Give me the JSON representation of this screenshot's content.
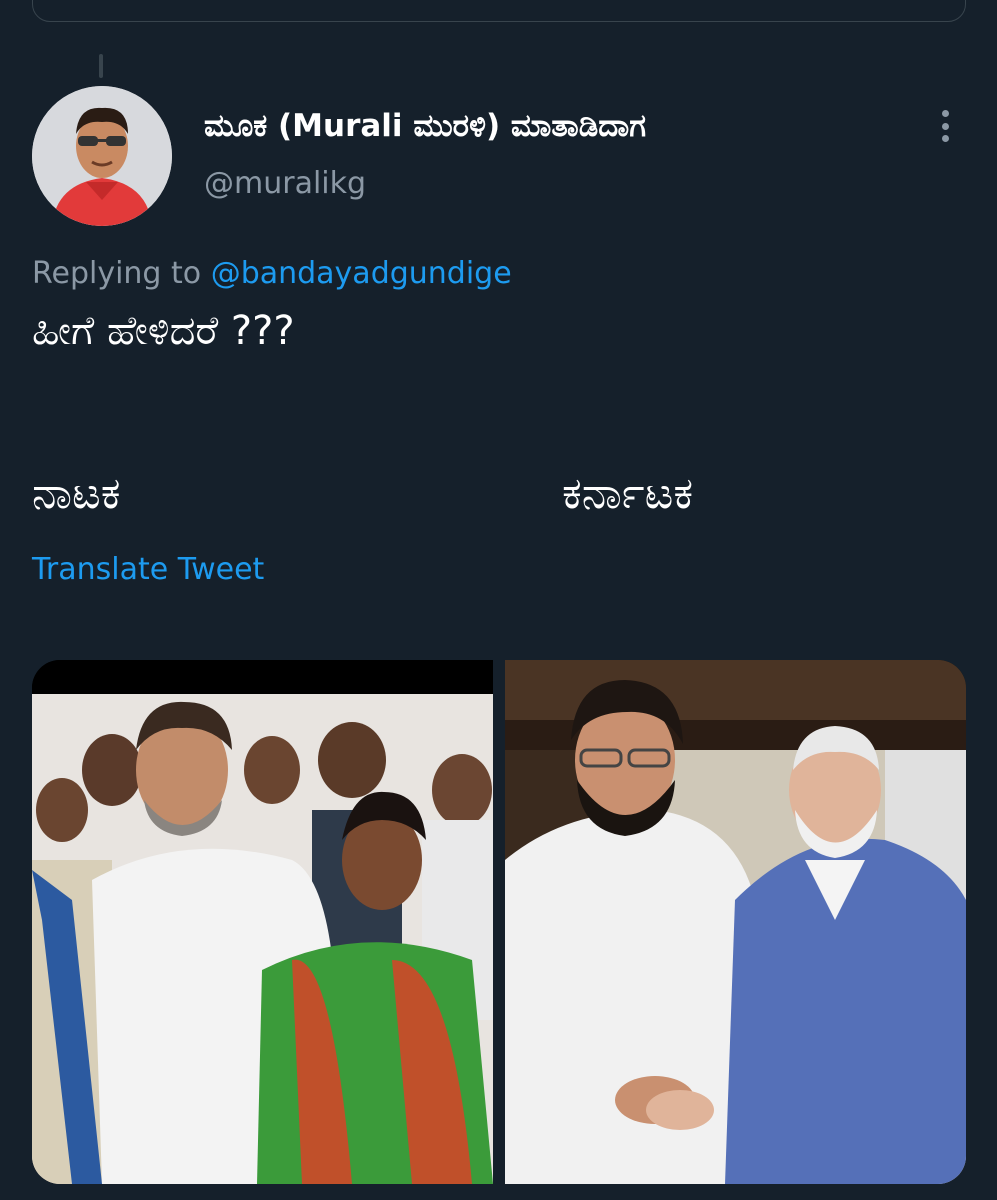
{
  "tweet": {
    "author": {
      "display_name": "ಮೂಕ (Murali ಮುರಳಿ) ಮಾತಾಡಿದಾಗ",
      "handle": "@muralikg"
    },
    "replying_prefix": "Replying to",
    "replying_to": "@bandayadgundige",
    "text_line1": "ಹೀಗೆ ಹೇಳಿದರೆ ???",
    "word_left": "ನಾಟಕ",
    "word_right": "ಕರ್ನಾಟಕ",
    "translate_label": "Translate Tweet",
    "icons": {
      "more": "more-vertical-icon"
    },
    "media": [
      {
        "description": "photo-left"
      },
      {
        "description": "photo-right"
      }
    ]
  },
  "colors": {
    "background": "#15202b",
    "link": "#1d9bf0",
    "secondary_text": "#8b98a5",
    "border": "#38444d"
  }
}
